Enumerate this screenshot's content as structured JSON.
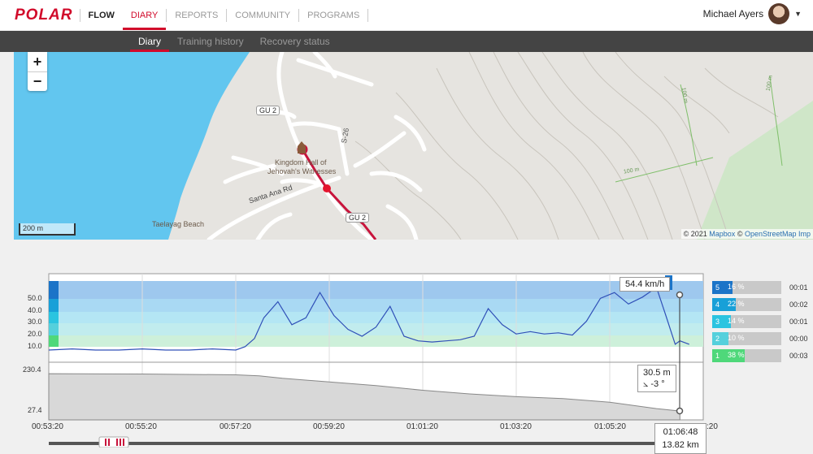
{
  "nav": {
    "brand": "POLAR",
    "flow": "FLOW",
    "items": [
      "DIARY",
      "REPORTS",
      "COMMUNITY",
      "PROGRAMS"
    ],
    "user_name": "Michael Ayers"
  },
  "subnav": {
    "items": [
      "Diary",
      "Training history",
      "Recovery status"
    ]
  },
  "map": {
    "zoom_in": "+",
    "zoom_out": "−",
    "scale": "200 m",
    "attribution_prefix": "© 2021 ",
    "attribution_mapbox": "Mapbox",
    "attribution_mid": " © ",
    "attribution_osm": "OpenStreetMap Imp",
    "labels": {
      "gu2": "GU 2",
      "s26": "S-26",
      "poi": "Kingdom Hall of",
      "poi2": "Jehovah's Witnesses",
      "road": "Santa Ana Rd",
      "beach": "Taelayag Beach",
      "gu_other": "GU 2",
      "contour1": "100 m",
      "contour2": "100 m",
      "contour3": "100 m"
    }
  },
  "chart": {
    "speed_tooltip": "54.4 km/h",
    "alt_tooltip_value": "30.5 m",
    "alt_tooltip_slope": "-3 °",
    "cursor_time": "01:06:48",
    "cursor_dist": "13.82 km",
    "alt_top": "230.4",
    "alt_bottom": "27.4",
    "speed_ticks": [
      "50.0",
      "40.0",
      "30.0",
      "20.0",
      "10.0"
    ],
    "x_ticks": [
      "00:53:20",
      "00:55:20",
      "00:57:20",
      "00:59:20",
      "01:01:20",
      "01:03:20",
      "01:05:20",
      ":20"
    ],
    "zones": [
      {
        "num": "5",
        "pct": "16 %",
        "time": "00:01",
        "color": "#1b74c8",
        "fill": 0.16
      },
      {
        "num": "4",
        "pct": "22 %",
        "time": "00:02",
        "color": "#18a0d8",
        "fill": 0.22
      },
      {
        "num": "3",
        "pct": "14 %",
        "time": "00:01",
        "color": "#2bc4e0",
        "fill": 0.14
      },
      {
        "num": "2",
        "pct": "10 %",
        "time": "00:00",
        "color": "#55d0dc",
        "fill": 0.1
      },
      {
        "num": "1",
        "pct": "38 %",
        "time": "00:03",
        "color": "#4fd87a",
        "fill": 0.38
      }
    ]
  },
  "chart_data": {
    "type": "line",
    "x_tick_labels": [
      "00:53:20",
      "00:55:20",
      "00:57:20",
      "00:59:20",
      "01:01:20",
      "01:03:20",
      "01:05:20"
    ],
    "series": [
      {
        "name": "speed",
        "unit": "km/h",
        "x_min": [
          0,
          0.5,
          1,
          1.5,
          2,
          2.5,
          3,
          3.5,
          4,
          4.2,
          4.4,
          4.6,
          4.9,
          5.2,
          5.5,
          5.8,
          6.1,
          6.4,
          6.7,
          7.0,
          7.3,
          7.6,
          7.9,
          8.2,
          8.5,
          8.8,
          9.1,
          9.4,
          9.7,
          10.0,
          10.3,
          10.6,
          10.9,
          11.2,
          11.5,
          11.8,
          12.1,
          12.4,
          12.7,
          13.0,
          13.2,
          13.4,
          13.5,
          13.7
        ],
        "values": [
          0,
          1,
          0,
          0,
          1,
          0,
          0,
          1,
          0,
          3,
          10,
          28,
          42,
          22,
          28,
          50,
          30,
          18,
          12,
          20,
          38,
          12,
          8,
          7,
          8,
          9,
          12,
          36,
          22,
          14,
          16,
          14,
          15,
          13,
          25,
          45,
          50,
          40,
          46,
          54.4,
          30,
          5,
          8,
          5
        ]
      },
      {
        "name": "altitude",
        "unit": "m",
        "x_min": [
          0,
          2,
          4,
          4.5,
          5,
          6,
          7,
          8,
          9,
          10,
          11,
          12,
          13,
          13.5
        ],
        "values": [
          230,
          228,
          224,
          218,
          205,
          185,
          165,
          140,
          120,
          105,
          95,
          75,
          40,
          27
        ]
      }
    ],
    "speed_ylim": [
      0,
      60
    ],
    "altitude_ylim": [
      27.4,
      230.4
    ]
  }
}
